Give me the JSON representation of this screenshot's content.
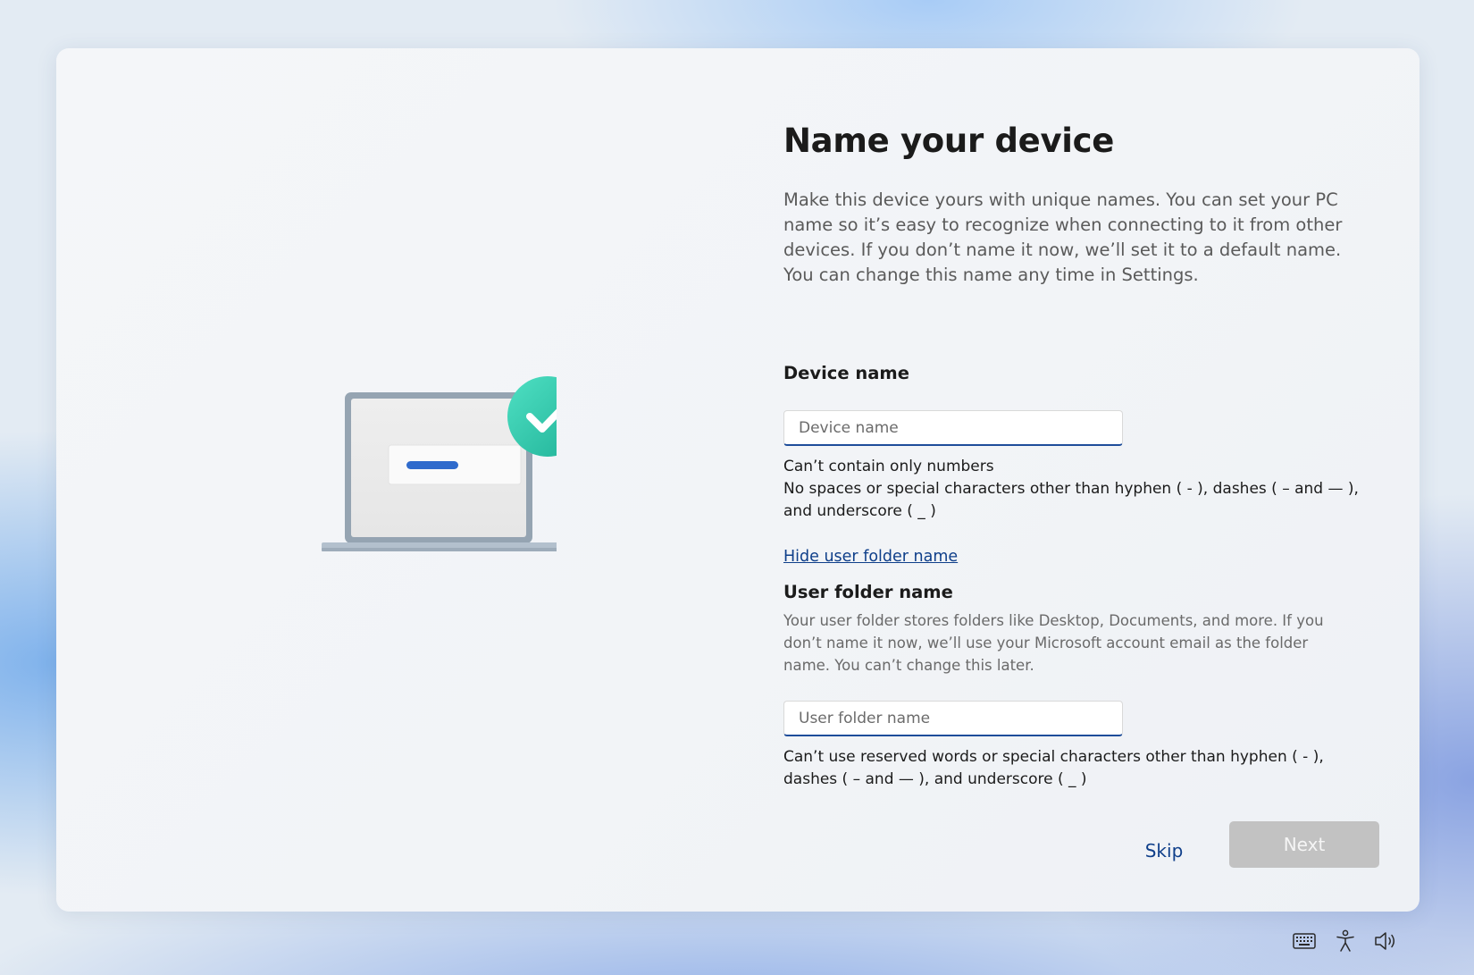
{
  "page": {
    "title": "Name your device",
    "description": "Make this device yours with unique names. You can set your PC name so it’s easy to recognize when connecting to it from other devices. If you don’t name it now, we’ll set it to a default name. You can change this name any time in Settings."
  },
  "device_name": {
    "label": "Device name",
    "placeholder": "Device name",
    "value": "",
    "rule_1": "Can’t contain only numbers",
    "rule_2": "No spaces or special characters other than hyphen ( - ), dashes ( – and — ), and underscore ( _ )"
  },
  "user_folder": {
    "toggle_link": "Hide user folder name",
    "label": "User folder name",
    "description": "Your user folder stores folders like Desktop, Documents, and more. If you don’t name it now, we’ll use your Microsoft account email as the folder name. You can’t change this later.",
    "placeholder": "User folder name",
    "value": "",
    "rule": "Can’t use reserved words or special characters other than hyphen ( - ), dashes ( – and — ), and underscore ( _ )"
  },
  "buttons": {
    "skip": "Skip",
    "next": "Next",
    "next_enabled": false
  },
  "system_icons": [
    "keyboard-icon",
    "accessibility-icon",
    "volume-icon"
  ],
  "colors": {
    "accent": "#1e4d9a",
    "link": "#0f3f8a",
    "check_badge": "#2cc9a8",
    "disabled_button": "#c2c2c2"
  }
}
